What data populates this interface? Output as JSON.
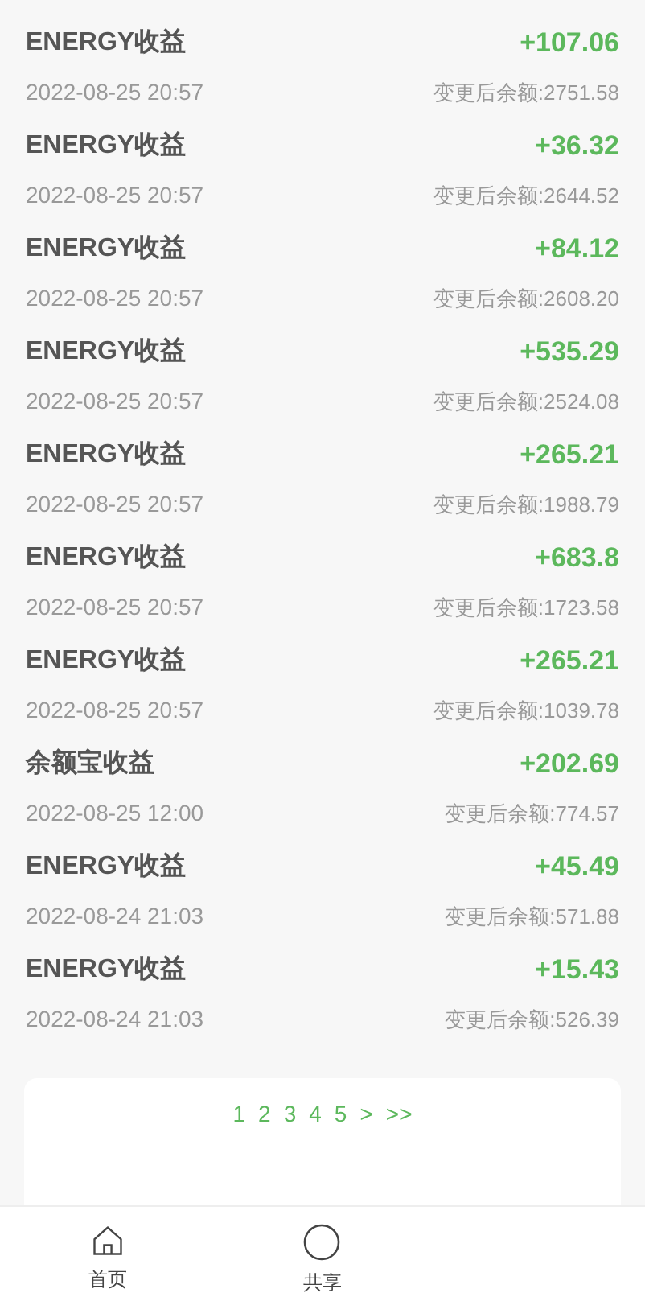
{
  "records": [
    {
      "title": "ENERGY收益",
      "amount": "+107.06",
      "time": "2022-08-25 20:57",
      "balance": "变更后余额:2751.58"
    },
    {
      "title": "ENERGY收益",
      "amount": "+36.32",
      "time": "2022-08-25 20:57",
      "balance": "变更后余额:2644.52"
    },
    {
      "title": "ENERGY收益",
      "amount": "+84.12",
      "time": "2022-08-25 20:57",
      "balance": "变更后余额:2608.20"
    },
    {
      "title": "ENERGY收益",
      "amount": "+535.29",
      "time": "2022-08-25 20:57",
      "balance": "变更后余额:2524.08"
    },
    {
      "title": "ENERGY收益",
      "amount": "+265.21",
      "time": "2022-08-25 20:57",
      "balance": "变更后余额:1988.79"
    },
    {
      "title": "ENERGY收益",
      "amount": "+683.8",
      "time": "2022-08-25 20:57",
      "balance": "变更后余额:1723.58"
    },
    {
      "title": "ENERGY收益",
      "amount": "+265.21",
      "time": "2022-08-25 20:57",
      "balance": "变更后余额:1039.78"
    },
    {
      "title": "余额宝收益",
      "amount": "+202.69",
      "time": "2022-08-25 12:00",
      "balance": "变更后余额:774.57"
    },
    {
      "title": "ENERGY收益",
      "amount": "+45.49",
      "time": "2022-08-24 21:03",
      "balance": "变更后余额:571.88"
    },
    {
      "title": "ENERGY收益",
      "amount": "+15.43",
      "time": "2022-08-24 21:03",
      "balance": "变更后余额:526.39"
    }
  ],
  "pagination": [
    "1",
    "2",
    "3",
    "4",
    "5",
    ">",
    ">>"
  ],
  "bottom_nav": [
    {
      "kind": "home",
      "label": "首页"
    },
    {
      "kind": "circle",
      "label": "共享"
    }
  ]
}
